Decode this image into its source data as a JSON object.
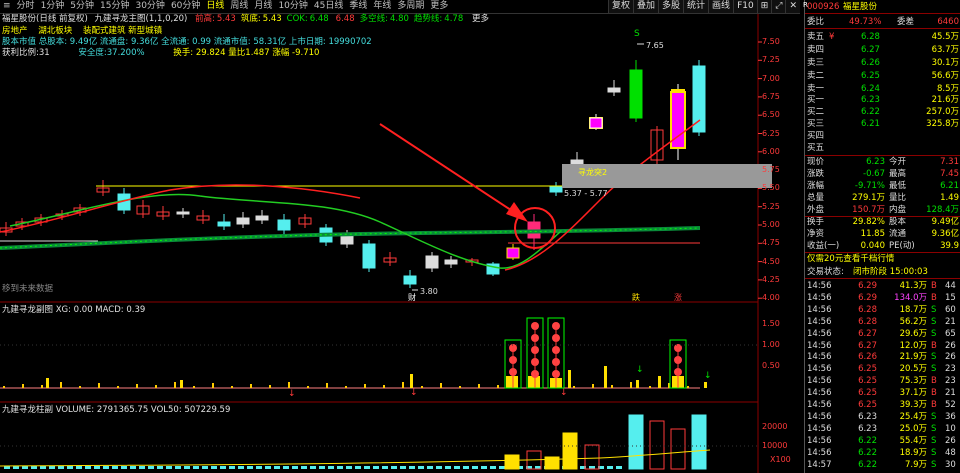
{
  "top_tabs": [
    "分时",
    "1分钟",
    "5分钟",
    "15分钟",
    "30分钟",
    "60分钟",
    "日线",
    "周线",
    "月线",
    "10分钟",
    "45日线",
    "季线",
    "年线",
    "多周期",
    "更多"
  ],
  "active_tab": "日线",
  "toolbar": [
    "复权",
    "叠加",
    "多股",
    "统计",
    "画线",
    "F10"
  ],
  "window_icons": [
    "⊞",
    "⤢",
    "✕"
  ],
  "main_header": {
    "name": "福星股份(日线 前复权)",
    "indicator": "九建寻龙主图(1,1,0,20)",
    "fields": [
      {
        "label": "前高:",
        "value": "5.43"
      },
      {
        "label": "筑底:",
        "value": "5.43"
      },
      {
        "label": "COK:",
        "value": "6.48"
      },
      {
        "label": "",
        "value": "6.48"
      },
      {
        "label": "多空线:",
        "value": "4.80"
      },
      {
        "label": "趋势线:",
        "value": "4.78"
      }
    ],
    "more": "更多",
    "row2": [
      "房地产",
      "湖北板块",
      "装配式建筑 新型城镇"
    ],
    "row3": "股本市值  总股本: 9.49亿  流通盘: 9.36亿  全流通: 0.99  流通市值: 58.31亿  上市日期: 19990702",
    "row4a": "获利比例:31",
    "row4b": "安全度:37.200%",
    "row4c": "换手: 29.824  量比1.487  涨幅 -9.710",
    "notice": "移到未来数据"
  },
  "price_labels": [
    "7.50",
    "7.25",
    "7.00",
    "6.75",
    "6.50",
    "6.25",
    "6.00",
    "5.75",
    "5.50",
    "5.25",
    "5.00",
    "4.75",
    "4.50",
    "4.25",
    "4.00"
  ],
  "annotations": {
    "high": "7.65",
    "low": "3.80",
    "signal_box": "寻龙突2",
    "range": "5.37 - 5.77",
    "marker_cai": "财",
    "marker_die": "跌",
    "marker_zhang": "涨",
    "marker_s": "S"
  },
  "xg_header": "九建寻龙副图  XG: 0.00  MACD: 0.39",
  "xg_labels": [
    "1.50",
    "1.00",
    "0.50"
  ],
  "vol_header": "九建寻龙柱副  VOLUME: 2791365.75  VOL50: 507229.59",
  "vol_labels": [
    "20000",
    "10000",
    "X100"
  ],
  "quote": {
    "code": "000926",
    "name": "福星股份",
    "weibi_label": "委比",
    "weibi_value": "49.73%",
    "weicha_label": "委差",
    "weicha_value": "6460",
    "asks": [
      {
        "label": "卖五",
        "flag": "¥",
        "price": "6.28",
        "vol": "45.5万"
      },
      {
        "label": "卖四",
        "flag": "",
        "price": "6.27",
        "vol": "63.7万"
      },
      {
        "label": "卖三",
        "flag": "",
        "price": "6.26",
        "vol": "30.1万"
      },
      {
        "label": "卖二",
        "flag": "",
        "price": "6.25",
        "vol": "56.6万"
      },
      {
        "label": "卖一",
        "flag": "",
        "price": "6.24",
        "vol": "8.5万"
      }
    ],
    "bids": [
      {
        "label": "买一",
        "price": "6.23",
        "vol": "21.6万"
      },
      {
        "label": "买二",
        "price": "6.22",
        "vol": "257.0万"
      },
      {
        "label": "买三",
        "price": "6.21",
        "vol": "325.8万"
      },
      {
        "label": "买四",
        "price": "",
        "vol": ""
      },
      {
        "label": "买五",
        "price": "",
        "vol": ""
      }
    ],
    "stats": [
      {
        "l1": "现价",
        "v1": "6.23",
        "l2": "今开",
        "v2": "7.31"
      },
      {
        "l1": "涨跌",
        "v1": "-0.67",
        "l2": "最高",
        "v2": "7.45"
      },
      {
        "l1": "涨幅",
        "v1": "-9.71%",
        "l2": "最低",
        "v2": "6.21"
      },
      {
        "l1": "总量",
        "v1": "279.1万",
        "l2": "量比",
        "v2": "1.49"
      },
      {
        "l1": "外盘",
        "v1": "150.7万",
        "l2": "内盘",
        "v2": "128.4万"
      }
    ],
    "stats2": [
      {
        "l1": "换手",
        "v1": "29.82%",
        "l2": "股本",
        "v2": "9.49亿"
      },
      {
        "l1": "净资",
        "v1": "11.85",
        "l2": "流通",
        "v2": "9.36亿"
      },
      {
        "l1": "收益(一)",
        "v1": "0.040",
        "l2": "PE(动)",
        "v2": "39.9"
      }
    ],
    "promo": "仅需20元查看千档行情",
    "status_label": "交易状态:",
    "status_value": "闭市阶段 15:00:03",
    "ticks": [
      {
        "t": "14:56",
        "p": "6.29",
        "v": "41.3万",
        "s": "B",
        "n": "44"
      },
      {
        "t": "14:56",
        "p": "6.29",
        "v": "134.0万",
        "s": "B",
        "n": "15"
      },
      {
        "t": "14:56",
        "p": "6.28",
        "v": "18.7万",
        "s": "S",
        "n": "60"
      },
      {
        "t": "14:56",
        "p": "6.28",
        "v": "56.2万",
        "s": "S",
        "n": "21"
      },
      {
        "t": "14:56",
        "p": "6.27",
        "v": "29.6万",
        "s": "S",
        "n": "65"
      },
      {
        "t": "14:56",
        "p": "6.27",
        "v": "12.0万",
        "s": "B",
        "n": "26"
      },
      {
        "t": "14:56",
        "p": "6.26",
        "v": "21.9万",
        "s": "S",
        "n": "26"
      },
      {
        "t": "14:56",
        "p": "6.25",
        "v": "20.5万",
        "s": "S",
        "n": "23"
      },
      {
        "t": "14:56",
        "p": "6.25",
        "v": "75.3万",
        "s": "B",
        "n": "23"
      },
      {
        "t": "14:56",
        "p": "6.25",
        "v": "37.1万",
        "s": "B",
        "n": "21"
      },
      {
        "t": "14:56",
        "p": "6.25",
        "v": "39.3万",
        "s": "B",
        "n": "52"
      },
      {
        "t": "14:56",
        "p": "6.23",
        "v": "25.4万",
        "s": "S",
        "n": "36"
      },
      {
        "t": "14:56",
        "p": "6.23",
        "v": "25.0万",
        "s": "S",
        "n": "10"
      },
      {
        "t": "14:56",
        "p": "6.22",
        "v": "55.4万",
        "s": "S",
        "n": "26"
      },
      {
        "t": "14:56",
        "p": "6.22",
        "v": "18.9万",
        "s": "S",
        "n": "48"
      },
      {
        "t": "14:57",
        "p": "6.22",
        "v": "7.9万",
        "s": "S",
        "n": "30"
      }
    ]
  }
}
